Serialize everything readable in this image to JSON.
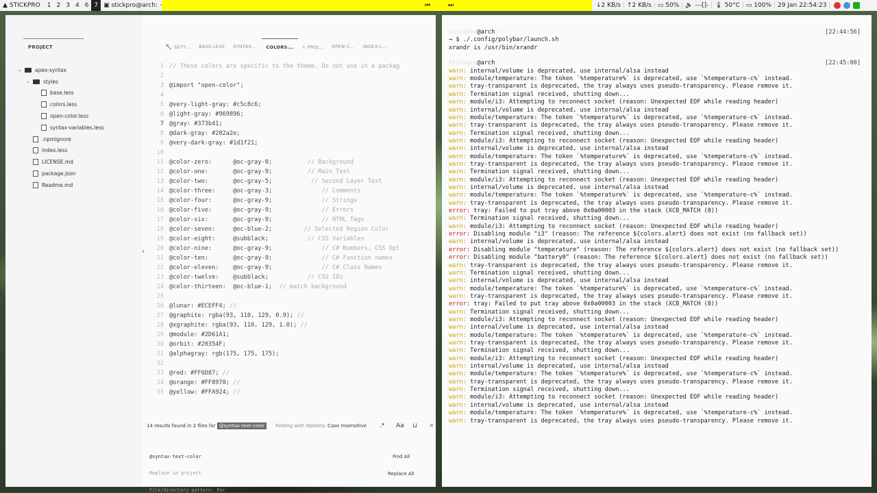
{
  "topbar": {
    "brand": "STICKPRO",
    "workspaces": [
      "1",
      "2",
      "3",
      "4",
      "6",
      "7"
    ],
    "active_workspace": "7",
    "window_title": "stickpro@arch: ~",
    "net_down": "2 KB/s",
    "net_up": "2 KB/s",
    "cpu": "50%",
    "volume": "---[]-",
    "temp": "50°C",
    "battery": "100%",
    "datetime": "29 Jan 22:54:23",
    "accent": "#ffff00"
  },
  "editor": {
    "project_label": "PROJECT",
    "tree": [
      {
        "label": "apex-syntax",
        "kind": "folder",
        "depth": 0,
        "open": true
      },
      {
        "label": "styles",
        "kind": "folder",
        "depth": 1,
        "open": true
      },
      {
        "label": "base.less",
        "kind": "file",
        "depth": 2
      },
      {
        "label": "colors.less",
        "kind": "file",
        "depth": 2
      },
      {
        "label": "open-color.less",
        "kind": "file",
        "depth": 2
      },
      {
        "label": "syntax-variables.less",
        "kind": "file",
        "depth": 2
      },
      {
        "label": ".npmignore",
        "kind": "file",
        "depth": 1
      },
      {
        "label": "index.less",
        "kind": "file",
        "depth": 1
      },
      {
        "label": "LICENSE.md",
        "kind": "file",
        "depth": 1
      },
      {
        "label": "package.json",
        "kind": "file",
        "depth": 1
      },
      {
        "label": "Readme.md",
        "kind": "file",
        "depth": 1
      }
    ],
    "tabs": [
      {
        "label": "SETT…",
        "icon": "wrench-icon"
      },
      {
        "label": "BASE.LESS"
      },
      {
        "label": "SYNTAX-…"
      },
      {
        "label": "COLORS.…",
        "active": true
      },
      {
        "label": "PROJ…",
        "icon": "search-icon"
      },
      {
        "label": "OPEN-C…",
        "italic": true
      },
      {
        "label": "INDEX.L…"
      }
    ],
    "current_line": "7",
    "code": [
      {
        "n": "1",
        "t": "// These colors are specific to the theme. Do not use in a packag",
        "c": true
      },
      {
        "n": "2",
        "t": ""
      },
      {
        "n": "3",
        "t": "@import \"open-color\";"
      },
      {
        "n": "4",
        "t": ""
      },
      {
        "n": "5",
        "t": "@very-light-gray: #c5c8c6;"
      },
      {
        "n": "6",
        "t": "@light-gray: #969896;"
      },
      {
        "n": "7",
        "t": "@gray: #373b41;"
      },
      {
        "n": "8",
        "t": "@dark-gray: #282a2e;"
      },
      {
        "n": "9",
        "t": "@very-dark-gray: #1d1f21;"
      },
      {
        "n": "10",
        "t": ""
      },
      {
        "n": "11",
        "t": "@color-zero:      @oc-gray-0;",
        "cm": "          // Background"
      },
      {
        "n": "12",
        "t": "@color-one:       @oc-gray-9;",
        "cm": "          // Main Text"
      },
      {
        "n": "13",
        "t": "@color-two:       @oc-gray-5;",
        "cm": "           // Second Layer Text"
      },
      {
        "n": "14",
        "t": "@color-three:     @oc-gray-3;",
        "cm": "              // Comments"
      },
      {
        "n": "15",
        "t": "@color-four:      @oc-gray-9;",
        "cm": "              // Strings"
      },
      {
        "n": "16",
        "t": "@color-five:      @oc-gray-9;",
        "cm": "              // Errors"
      },
      {
        "n": "17",
        "t": "@color-six:       @oc-gray-9;",
        "cm": "              // HTML Tags"
      },
      {
        "n": "18",
        "t": "@color-seven:     @oc-blue-2;",
        "cm": "         // Selected Region Color"
      },
      {
        "n": "19",
        "t": "@color-eight:     @subblack;",
        "cm": "           // CSS Variables"
      },
      {
        "n": "20",
        "t": "@color-nine:      @oc-gray-9;",
        "cm": "              // C# Numbers, CSS Opt"
      },
      {
        "n": "21",
        "t": "@color-ten:       @oc-gray-9;",
        "cm": "              // C# Function names"
      },
      {
        "n": "22",
        "t": "@color-eleven:    @oc-gray-9;",
        "cm": "              // C# Class Names"
      },
      {
        "n": "23",
        "t": "@color-twelve:    @subblack;",
        "cm": "           // CSS IDs"
      },
      {
        "n": "24",
        "t": "@color-thirteen:  @oc-blue-1;",
        "cm": "  // match background"
      },
      {
        "n": "25",
        "t": ""
      },
      {
        "n": "26",
        "t": "@lunar: #ECEFF4;",
        "cm": " //"
      },
      {
        "n": "27",
        "t": "@graphite: rgba(93, 110, 129, 0.9);",
        "cm": " //"
      },
      {
        "n": "28",
        "t": "@xgraphite: rgba(93, 110, 129, 1.0);",
        "cm": " //"
      },
      {
        "n": "29",
        "t": "@module: #2D61A1;"
      },
      {
        "n": "30",
        "t": "@orbit: #20354F;"
      },
      {
        "n": "31",
        "t": "@alphagray: rgb(175, 175, 175);"
      },
      {
        "n": "32",
        "t": ""
      },
      {
        "n": "33",
        "t": "@red: #FF6D87;",
        "cm": " //"
      },
      {
        "n": "34",
        "t": "@orange: #FF8970;",
        "cm": " //"
      },
      {
        "n": "35",
        "t": "@yellow: #FFA924;",
        "cm": " //"
      }
    ],
    "find": {
      "status_prefix": "14 results found in 2 files for",
      "query_badge": "@syntax-text-color",
      "options_label": "Finding with Options:",
      "options_value": "Case Insensitive",
      "find_value": "@syntax-text-color",
      "replace_placeholder": "Replace in project",
      "pattern_placeholder": "File/directory pattern: For",
      "find_all": "Find All",
      "replace_all": "Replace All",
      "regex_label": ".*",
      "case_label": "Aa",
      "close_label": "×"
    }
  },
  "terminal": {
    "user": "stickpro",
    "host": "@arch",
    "prompt_cwd": "~",
    "blocks": [
      {
        "time": "[22:44:56]",
        "lines": [
          {
            "k": "cmd",
            "t": "→ $ ./.config/polybar/launch.sh"
          },
          {
            "k": "out",
            "t": "xrandr is /usr/bin/xrandr"
          }
        ]
      },
      {
        "time": "[22:45:00]",
        "lines": [
          {
            "k": "warn",
            "t": "internal/volume is deprecated, use internal/alsa instead"
          },
          {
            "k": "warn",
            "t": "module/temperature: The token `%temperature%` is deprecated, use `%temperature-c%` instead."
          },
          {
            "k": "warn",
            "t": "tray-transparent is deprecated, the tray always uses pseudo-transparency. Please remove it."
          },
          {
            "k": "warn",
            "t": "Termination signal received, shutting down..."
          },
          {
            "k": "warn",
            "t": "module/i3: Attempting to reconnect socket (reason: Unexpected EOF while reading header)"
          },
          {
            "k": "warn",
            "t": "internal/volume is deprecated, use internal/alsa instead"
          },
          {
            "k": "warn",
            "t": "module/temperature: The token `%temperature%` is deprecated, use `%temperature-c%` instead."
          },
          {
            "k": "warn",
            "t": "tray-transparent is deprecated, the tray always uses pseudo-transparency. Please remove it."
          },
          {
            "k": "warn",
            "t": "Termination signal received, shutting down..."
          },
          {
            "k": "warn",
            "t": "module/i3: Attempting to reconnect socket (reason: Unexpected EOF while reading header)"
          },
          {
            "k": "warn",
            "t": "internal/volume is deprecated, use internal/alsa instead"
          },
          {
            "k": "warn",
            "t": "module/temperature: The token `%temperature%` is deprecated, use `%temperature-c%` instead."
          },
          {
            "k": "warn",
            "t": "tray-transparent is deprecated, the tray always uses pseudo-transparency. Please remove it."
          },
          {
            "k": "warn",
            "t": "Termination signal received, shutting down..."
          },
          {
            "k": "warn",
            "t": "module/i3: Attempting to reconnect socket (reason: Unexpected EOF while reading header)"
          },
          {
            "k": "warn",
            "t": "internal/volume is deprecated, use internal/alsa instead"
          },
          {
            "k": "warn",
            "t": "module/temperature: The token `%temperature%` is deprecated, use `%temperature-c%` instead."
          },
          {
            "k": "warn",
            "t": "tray-transparent is deprecated, the tray always uses pseudo-transparency. Please remove it."
          },
          {
            "k": "error",
            "t": "tray: Failed to put tray above 0x0a00003 in the stack (XCB_MATCH (8))"
          },
          {
            "k": "warn",
            "t": "Termination signal received, shutting down..."
          },
          {
            "k": "warn",
            "t": "module/i3: Attempting to reconnect socket (reason: Unexpected EOF while reading header)"
          },
          {
            "k": "error",
            "t": "Disabling module \"i3\" (reason: The reference ${colors.alert} does not exist (no fallback set))"
          },
          {
            "k": "warn",
            "t": "internal/volume is deprecated, use internal/alsa instead"
          },
          {
            "k": "error",
            "t": "Disabling module \"temperature\" (reason: The reference ${colors.alert} does not exist (no fallback set))"
          },
          {
            "k": "error",
            "t": "Disabling module \"battery0\" (reason: The reference ${colors.alert} does not exist (no fallback set))"
          },
          {
            "k": "warn",
            "t": "tray-transparent is deprecated, the tray always uses pseudo-transparency. Please remove it."
          },
          {
            "k": "warn",
            "t": "Termination signal received, shutting down..."
          },
          {
            "k": "warn",
            "t": "internal/volume is deprecated, use internal/alsa instead"
          },
          {
            "k": "warn",
            "t": "module/temperature: The token `%temperature%` is deprecated, use `%temperature-c%` instead."
          },
          {
            "k": "warn",
            "t": "tray-transparent is deprecated, the tray always uses pseudo-transparency. Please remove it."
          },
          {
            "k": "error",
            "t": "tray: Failed to put tray above 0x0a00003 in the stack (XCB_MATCH (8))"
          },
          {
            "k": "warn",
            "t": "Termination signal received, shutting down..."
          },
          {
            "k": "warn",
            "t": "module/i3: Attempting to reconnect socket (reason: Unexpected EOF while reading header)"
          },
          {
            "k": "warn",
            "t": "internal/volume is deprecated, use internal/alsa instead"
          },
          {
            "k": "warn",
            "t": "module/temperature: The token `%temperature%` is deprecated, use `%temperature-c%` instead."
          },
          {
            "k": "warn",
            "t": "tray-transparent is deprecated, the tray always uses pseudo-transparency. Please remove it."
          },
          {
            "k": "warn",
            "t": "Termination signal received, shutting down..."
          },
          {
            "k": "warn",
            "t": "module/i3: Attempting to reconnect socket (reason: Unexpected EOF while reading header)"
          },
          {
            "k": "warn",
            "t": "internal/volume is deprecated, use internal/alsa instead"
          },
          {
            "k": "warn",
            "t": "module/temperature: The token `%temperature%` is deprecated, use `%temperature-c%` instead."
          },
          {
            "k": "warn",
            "t": "tray-transparent is deprecated, the tray always uses pseudo-transparency. Please remove it."
          },
          {
            "k": "warn",
            "t": "Termination signal received, shutting down..."
          },
          {
            "k": "warn",
            "t": "module/i3: Attempting to reconnect socket (reason: Unexpected EOF while reading header)"
          },
          {
            "k": "warn",
            "t": "internal/volume is deprecated, use internal/alsa instead"
          },
          {
            "k": "warn",
            "t": "module/temperature: The token `%temperature%` is deprecated, use `%temperature-c%` instead."
          },
          {
            "k": "warn",
            "t": "tray-transparent is deprecated, the tray always uses pseudo-transparency. Please remove it."
          }
        ]
      }
    ],
    "warn_prefix": "warn:",
    "error_prefix": "error:",
    "colors": {
      "warn": "#c8a800",
      "error": "#c81e1e"
    }
  }
}
